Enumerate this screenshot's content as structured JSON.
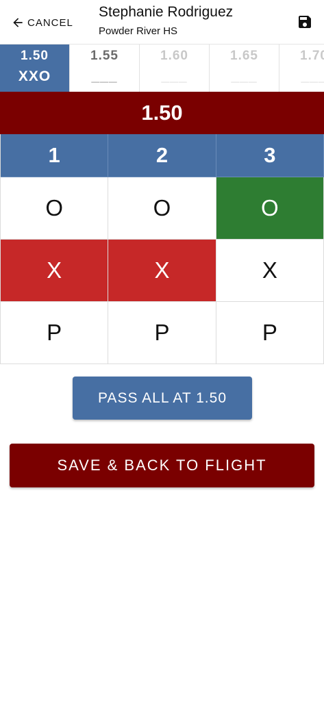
{
  "header": {
    "cancel_label": "CANCEL",
    "athlete_name": "Stephanie Rodriguez",
    "school": "Powder River HS",
    "cancel_icon": "arrow-left-icon",
    "save_icon": "floppy-disk-icon"
  },
  "heights": [
    {
      "height": "1.50",
      "result": "XXO",
      "state": "active"
    },
    {
      "height": "1.55",
      "result": "___",
      "state": "next"
    },
    {
      "height": "1.60",
      "result": "___",
      "state": "future"
    },
    {
      "height": "1.65",
      "result": "___",
      "state": "future"
    },
    {
      "height": "1.70",
      "result": "___",
      "state": "future"
    }
  ],
  "current_height": "1.50",
  "attempts": {
    "columns": [
      "1",
      "2",
      "3"
    ],
    "rows": [
      {
        "mark": "O",
        "selected": [
          false,
          false,
          true
        ]
      },
      {
        "mark": "X",
        "selected": [
          true,
          true,
          false
        ]
      },
      {
        "mark": "P",
        "selected": [
          false,
          false,
          false
        ]
      }
    ]
  },
  "buttons": {
    "pass_all": "PASS ALL AT 1.50",
    "save_back": "SAVE & BACK TO FLIGHT"
  },
  "colors": {
    "primary_blue": "#476fa3",
    "dark_red": "#7a0000",
    "success_green": "#2e7d32",
    "fail_red": "#c62828"
  }
}
